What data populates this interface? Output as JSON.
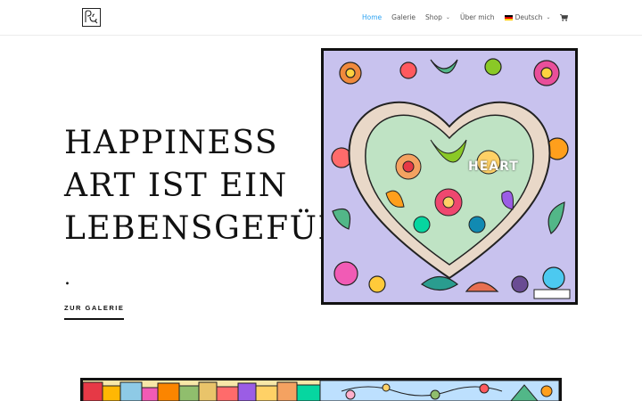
{
  "nav": {
    "items": [
      {
        "label": "Home",
        "active": true,
        "dropdown": false
      },
      {
        "label": "Galerie",
        "active": false,
        "dropdown": false
      },
      {
        "label": "Shop",
        "active": false,
        "dropdown": true
      },
      {
        "label": "Über mich",
        "active": false,
        "dropdown": false
      }
    ],
    "language": "Deutsch",
    "accent_color": "#2ea3f2"
  },
  "hero": {
    "title_lines": [
      "HAPPINESS",
      "ART IST EIN",
      "LEBENSGEFÜHL"
    ],
    "dot": ".",
    "cta_label": "ZUR GALERIE"
  },
  "artwork": {
    "label": "HEART"
  },
  "icons": {
    "logo": "logo-icon",
    "flag": "german-flag-icon",
    "cart": "cart-icon",
    "chevron": "chevron-down-icon"
  }
}
